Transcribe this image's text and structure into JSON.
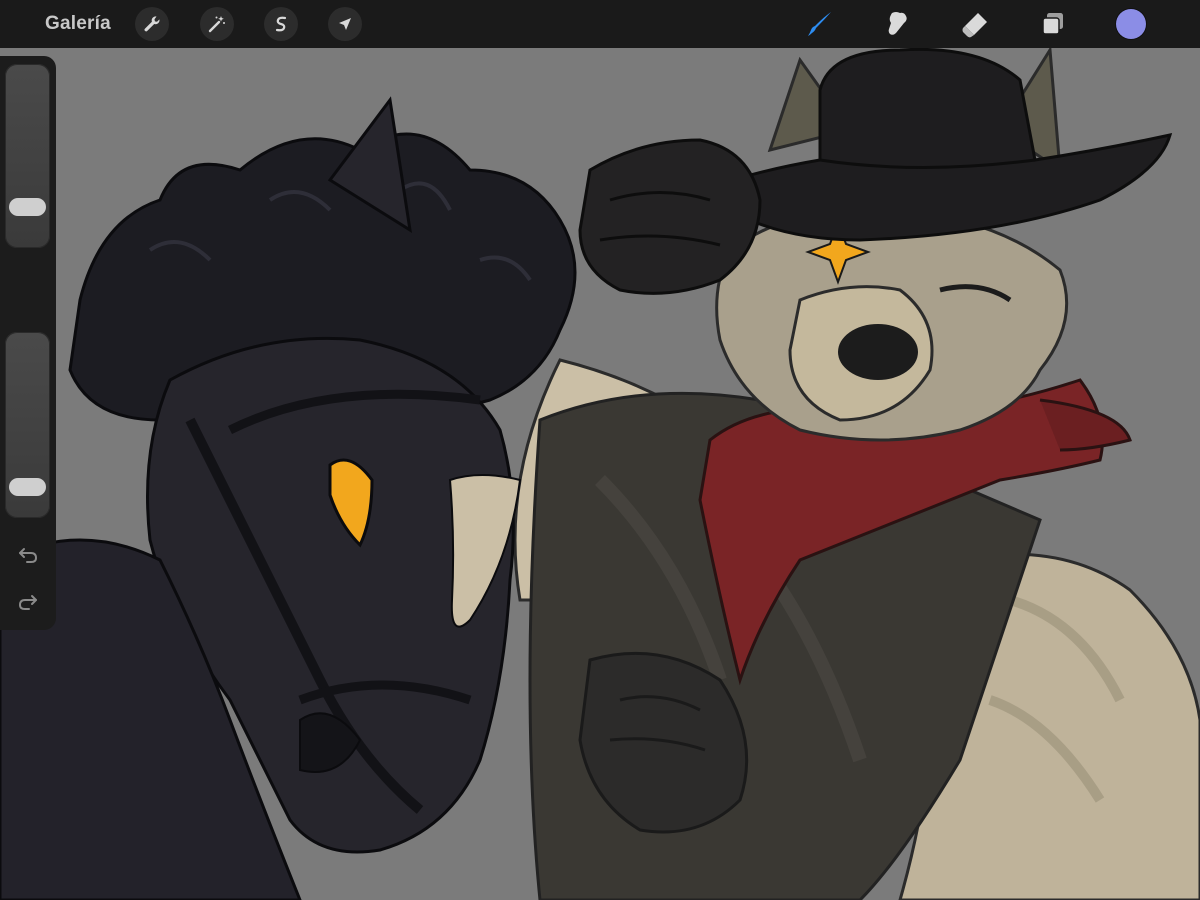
{
  "toolbar": {
    "gallery_label": "Galería",
    "left_tools": [
      {
        "icon": "wrench-icon",
        "name": "actions"
      },
      {
        "icon": "magic-wand-icon",
        "name": "adjustments"
      },
      {
        "icon": "selection-s-icon",
        "name": "selection"
      },
      {
        "icon": "arrow-cursor-icon",
        "name": "transform"
      }
    ],
    "right_tools": [
      {
        "icon": "brush-icon",
        "name": "paint",
        "active": true
      },
      {
        "icon": "smudge-icon",
        "name": "smudge"
      },
      {
        "icon": "eraser-icon",
        "name": "erase"
      },
      {
        "icon": "layers-icon",
        "name": "layers"
      }
    ],
    "current_color": "#8b8de6",
    "active_tool_color": "#2d8cf0"
  },
  "sidebar": {
    "brush_size": 0.17,
    "brush_opacity": 0.1,
    "modify_icon": "square-icon",
    "undo_icon": "undo-arrow-icon",
    "redo_icon": "redo-arrow-icon"
  },
  "canvas": {
    "background_color": "#7b7b7b",
    "artwork": "horse-and-wolf-cowboy-illustration"
  }
}
